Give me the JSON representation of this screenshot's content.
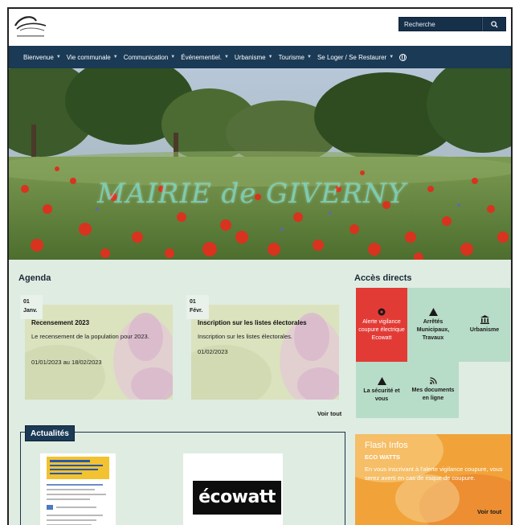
{
  "header": {
    "search_placeholder": "Recherche"
  },
  "nav": {
    "items": [
      {
        "label": "Bienvenue"
      },
      {
        "label": "Vie communale"
      },
      {
        "label": "Communication"
      },
      {
        "label": "Événementiel."
      },
      {
        "label": "Urbanisme"
      },
      {
        "label": "Tourisme"
      },
      {
        "label": "Se Loger / Se Restaurer"
      }
    ]
  },
  "hero": {
    "title": "MAIRIE de GIVERNY"
  },
  "agenda": {
    "heading": "Agenda",
    "events": [
      {
        "day": "01",
        "month": "Janv.",
        "title": "Recensement 2023",
        "text": "Le recensement de la population pour 2023.",
        "dates": "01/01/2023 au 18/02/2023"
      },
      {
        "day": "01",
        "month": "Févr.",
        "title": "Inscription sur les listes électorales",
        "text": "Inscription sur les listes électorales.",
        "dates": "01/02/2023"
      }
    ],
    "see_all": "Voir tout"
  },
  "acces": {
    "heading": "Accès directs",
    "tiles": [
      {
        "label": "Alerte vigilance coupure électrique Ecowatt",
        "icon": "alert-circle-icon",
        "color": "#e23b36"
      },
      {
        "label": "Arrêtés Municipaux, Travaux",
        "icon": "warning-triangle-icon"
      },
      {
        "label": "Urbanisme",
        "icon": "building-columns-icon"
      },
      {
        "label": "La sécurité et vous",
        "icon": "warning-triangle-icon"
      },
      {
        "label": "Mes documents en ligne",
        "icon": "rss-icon"
      }
    ]
  },
  "actualites": {
    "heading": "Actualités",
    "ecowatt_logo": "écowatt"
  },
  "flash": {
    "heading": "Flash Infos",
    "subtitle": "ECO WATTS",
    "text": "En vous inscrivant à l'alerte vigilance coupure, vous serez averti en cas de risque de coupure.",
    "see_all": "Voir tout"
  }
}
